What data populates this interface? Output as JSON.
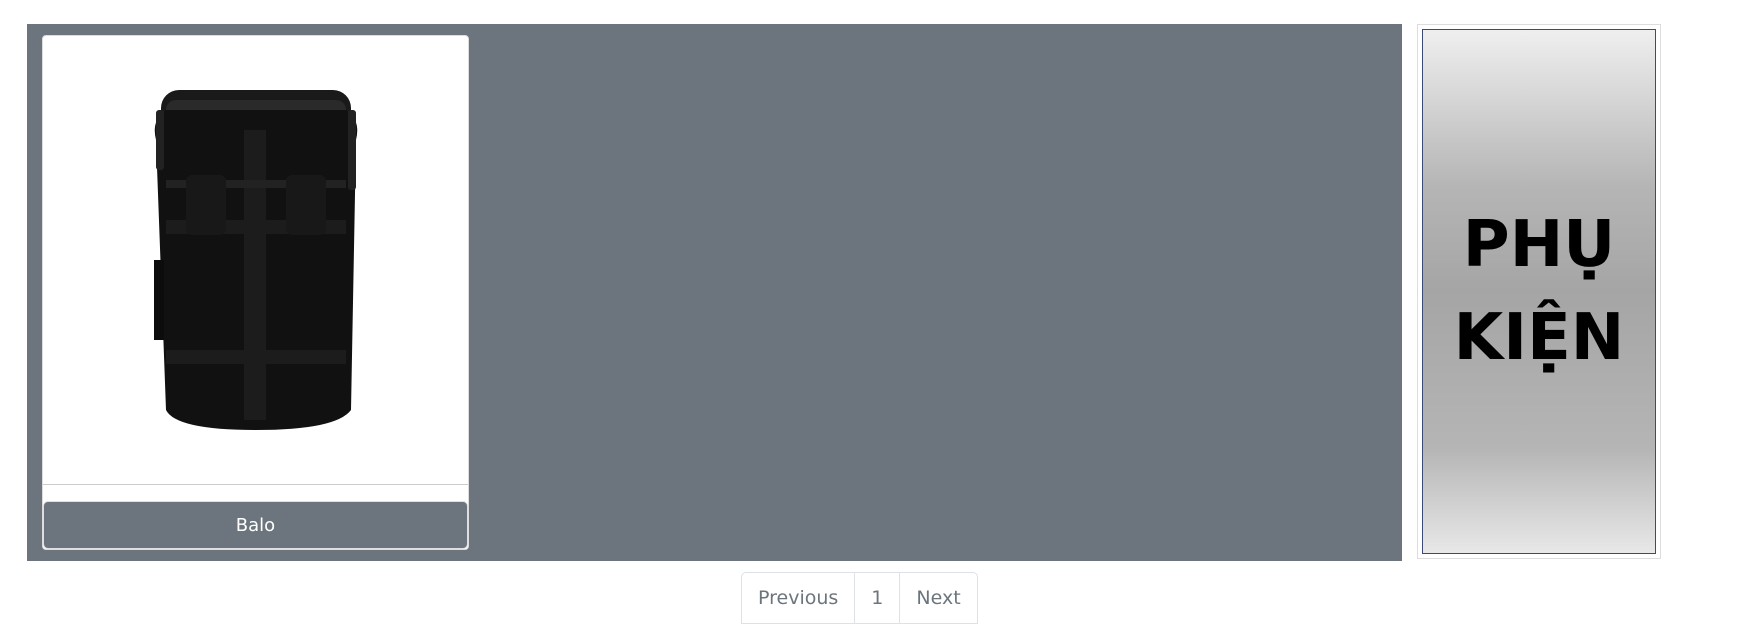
{
  "products": [
    {
      "name": "Balo",
      "image": "backpack-image"
    }
  ],
  "banner": {
    "line1": "PHỤ",
    "line2": "KIỆN"
  },
  "pagination": {
    "previous": "Previous",
    "current": "1",
    "next": "Next"
  },
  "colors": {
    "panel": "#6c757d",
    "button": "#6c757d"
  }
}
